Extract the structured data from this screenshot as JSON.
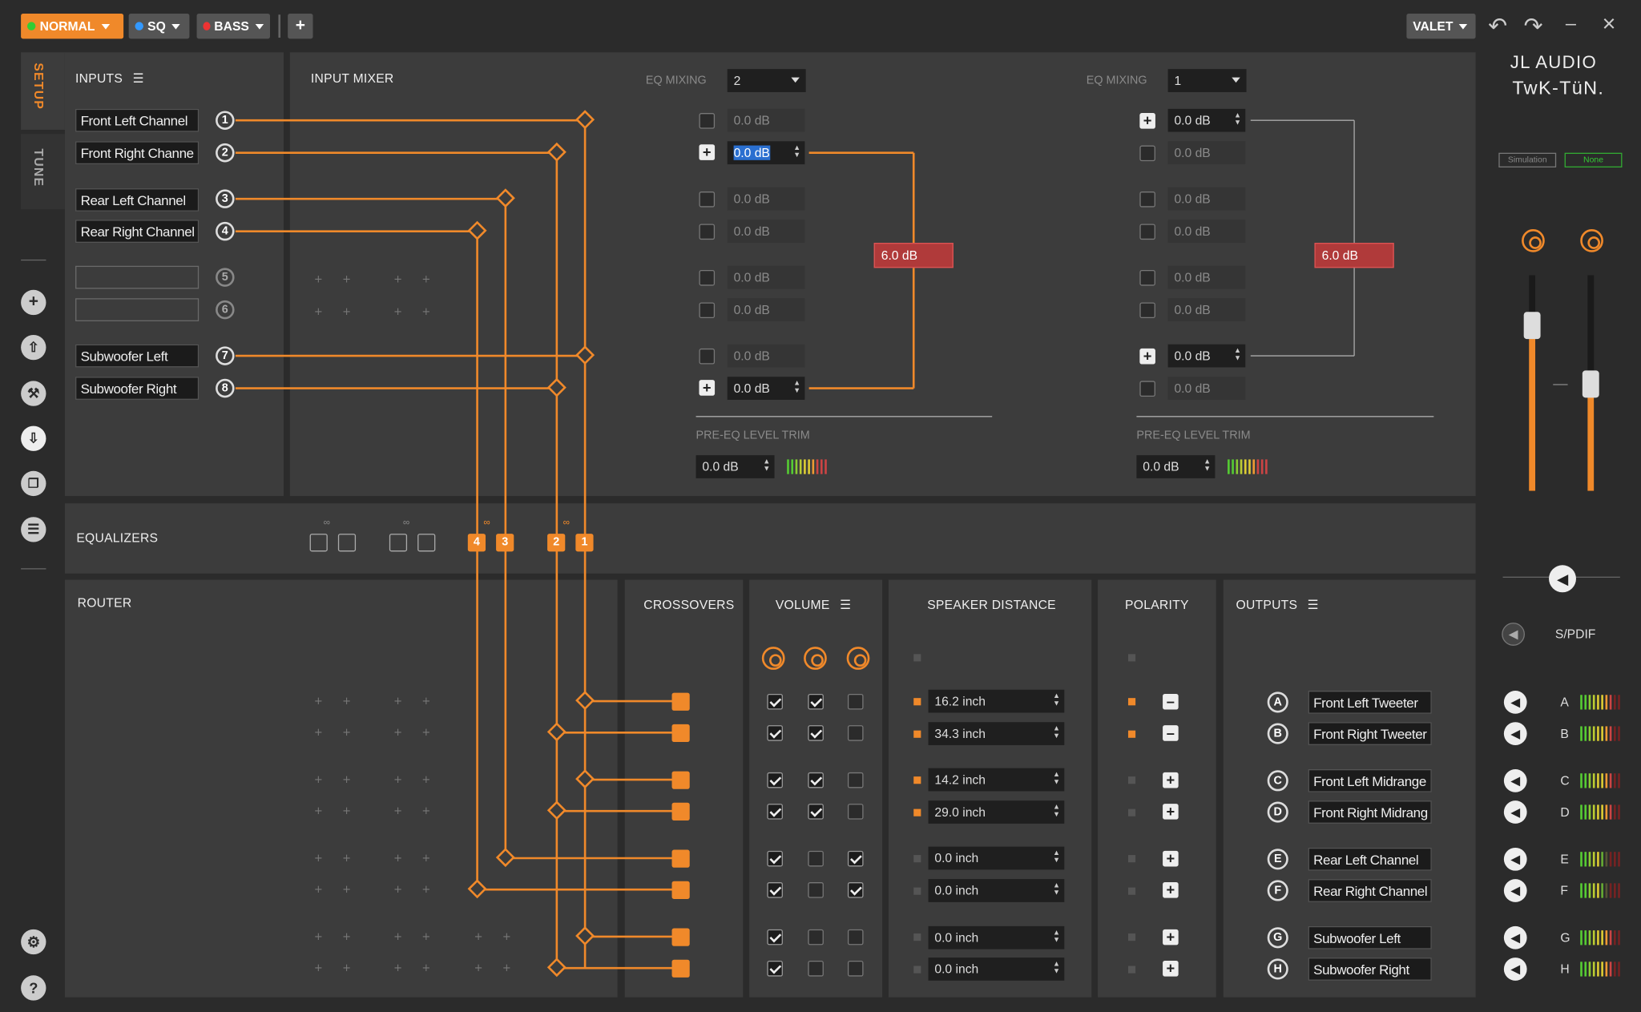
{
  "toolbar": {
    "mode": "NORMAL",
    "preset_sq": "SQ",
    "preset_bass": "BASS",
    "valet": "VALET",
    "add": "+",
    "undo": "↶",
    "redo": "↷",
    "minimize": "–",
    "close": "×"
  },
  "sidebar": {
    "tab_setup": "SETUP",
    "tab_tune": "TUNE"
  },
  "brand": {
    "line1": "JL AUDIO",
    "line2": "TwK-TüN.",
    "simulation": "Simulation",
    "none": "None"
  },
  "inputs": {
    "title": "INPUTS",
    "items": [
      {
        "label": "Front Left Channel",
        "n": "1"
      },
      {
        "label": "Front Right Channe",
        "n": "2"
      },
      {
        "label": "Rear Left Channel",
        "n": "3"
      },
      {
        "label": "Rear Right Channel",
        "n": "4"
      },
      {
        "label": "",
        "n": "5"
      },
      {
        "label": "",
        "n": "6"
      },
      {
        "label": "Subwoofer Left",
        "n": "7"
      },
      {
        "label": "Subwoofer Right",
        "n": "8"
      }
    ]
  },
  "mixer": {
    "title": "INPUT MIXER",
    "left": {
      "eq_label": "EQ MIXING",
      "eq_value": "2",
      "sum": "6.0 dB",
      "trim_label": "PRE-EQ LEVEL TRIM",
      "trim_value": "0.0 dB",
      "rows": [
        "0.0 dB",
        "0.0 dB",
        "0.0 dB",
        "0.0 dB",
        "0.0 dB",
        "0.0 dB",
        "0.0 dB",
        "0.0 dB"
      ]
    },
    "right": {
      "eq_label": "EQ MIXING",
      "eq_value": "1",
      "sum": "6.0 dB",
      "trim_label": "PRE-EQ LEVEL TRIM",
      "trim_value": "0.0 dB",
      "rows": [
        "0.0 dB",
        "0.0 dB",
        "0.0 dB",
        "0.0 dB",
        "0.0 dB",
        "0.0 dB",
        "0.0 dB",
        "0.0 dB"
      ]
    }
  },
  "equalizers": {
    "title": "EQUALIZERS",
    "tags": [
      "4",
      "3",
      "2",
      "1"
    ]
  },
  "router": {
    "title": "ROUTER"
  },
  "crossovers": {
    "title": "CROSSOVERS"
  },
  "volume": {
    "title": "VOLUME"
  },
  "speaker_distance": {
    "title": "SPEAKER DISTANCE",
    "values": [
      "16.2 inch",
      "34.3 inch",
      "14.2 inch",
      "29.0 inch",
      "0.0 inch",
      "0.0 inch",
      "0.0 inch",
      "0.0 inch"
    ]
  },
  "polarity": {
    "title": "POLARITY"
  },
  "outputs": {
    "title": "OUTPUTS",
    "items": [
      {
        "c": "A",
        "label": "Front Left Tweeter"
      },
      {
        "c": "B",
        "label": "Front Right Tweeter"
      },
      {
        "c": "C",
        "label": "Front Left Midrange"
      },
      {
        "c": "D",
        "label": "Front Right Midrang"
      },
      {
        "c": "E",
        "label": "Rear Left Channel"
      },
      {
        "c": "F",
        "label": "Rear Right Channel"
      },
      {
        "c": "G",
        "label": "Subwoofer Left"
      },
      {
        "c": "H",
        "label": "Subwoofer Right"
      }
    ]
  },
  "master": {
    "spdif": "S/PDIF"
  },
  "colors": {
    "accent": "#f0892a",
    "bg": "#2b2b2b",
    "panel": "#3c3c3c",
    "warn": "#b03a3a"
  }
}
